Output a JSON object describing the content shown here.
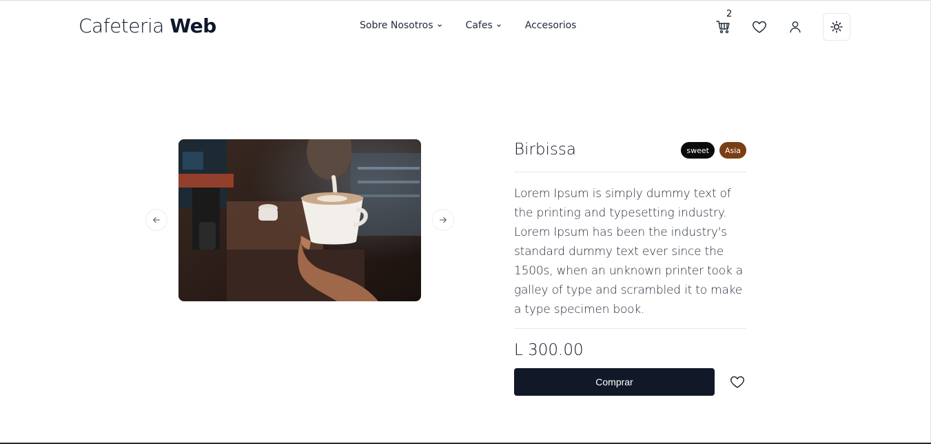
{
  "header": {
    "logo_light": "Cafeteria ",
    "logo_bold": "Web",
    "nav": [
      {
        "label": "Sobre Nosotros",
        "has_dropdown": true
      },
      {
        "label": "Cafes",
        "has_dropdown": true
      },
      {
        "label": "Accesorios",
        "has_dropdown": false
      }
    ],
    "cart_count": "2",
    "icons": [
      "cart-icon",
      "heart-icon",
      "user-icon",
      "sun-icon"
    ]
  },
  "product": {
    "title": "Birbissa",
    "tags": [
      {
        "label": "sweet",
        "color": "#0b0b0b"
      },
      {
        "label": "Asia",
        "color": "#7a3e14"
      }
    ],
    "description": "Lorem Ipsum is simply dummy text of the printing and typesetting industry. Lorem Ipsum has been the industry's standard dummy text ever since the 1500s, when an unknown printer took a galley of type and scrambled it to make a type specimen book.",
    "price": "L 300.00",
    "buy_label": "Comprar"
  },
  "colors": {
    "primary": "#111827",
    "tag_dark": "#0b0b0b",
    "tag_brown": "#7a3e14"
  }
}
